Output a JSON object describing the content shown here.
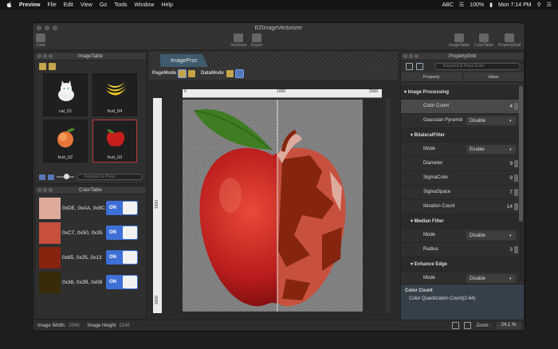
{
  "menubar": {
    "app": "Preview",
    "items": [
      "File",
      "Edit",
      "View",
      "Go",
      "Tools",
      "Window",
      "Help"
    ],
    "input": "ABC",
    "battery": "100%",
    "clock": "Mon 7:14 PM"
  },
  "window": {
    "title": "EZImageVectorizer"
  },
  "toolbar": {
    "load": "Load",
    "vectorize": "Vectorize",
    "export": "Export",
    "imagetable": "ImageTable",
    "colortable": "ColorTable",
    "propertygrid": "PropertyGrid"
  },
  "imagetable": {
    "title": "ImageTable",
    "items": [
      {
        "label": "cat_01"
      },
      {
        "label": "fruit_04"
      },
      {
        "label": "fruit_02"
      },
      {
        "label": "fruit_03"
      }
    ],
    "search_placeholder": "Keyword & Press"
  },
  "colortable": {
    "title": "ColorTable",
    "rows": [
      {
        "color": "#DEAA9C",
        "text": "0xDE, 0xAA, 0x9C",
        "state": "ON"
      },
      {
        "color": "#C7503F",
        "text": "0xC7, 0x50, 0x35",
        "state": "ON"
      },
      {
        "color": "#85250F",
        "text": "0x85, 0x25, 0x13",
        "state": "ON"
      },
      {
        "color": "#382B08",
        "text": "0x38, 0x2B, 0x08",
        "state": "ON"
      }
    ]
  },
  "center": {
    "tab": "ImageProc",
    "pagemode": "PageMode",
    "datamode": "DataMode",
    "ruler_top": [
      "0",
      "1000",
      "2000"
    ],
    "ruler_left": [
      "1000",
      "2000"
    ]
  },
  "propertygrid": {
    "title": "PropertyGrid",
    "search_placeholder": "Keyword & Press Enter",
    "col_property": "Property",
    "col_value": "Value",
    "rows": [
      {
        "name": "▾ Image Processing",
        "type": "group"
      },
      {
        "name": "Color Count",
        "value": "4",
        "type": "num",
        "selected": true
      },
      {
        "name": "Gaussian Pyramid",
        "value": "Disable",
        "type": "select"
      },
      {
        "name": "▾ BilateralFilter",
        "type": "group"
      },
      {
        "name": "Mode",
        "value": "Enable",
        "type": "select"
      },
      {
        "name": "Diameter",
        "value": "9",
        "type": "num"
      },
      {
        "name": "SigmaColor",
        "value": "9",
        "type": "num"
      },
      {
        "name": "SigmaSpace",
        "value": "7",
        "type": "num"
      },
      {
        "name": "Iteration Count",
        "value": "14",
        "type": "num"
      },
      {
        "name": "▾ Median Filter",
        "type": "group"
      },
      {
        "name": "Mode",
        "value": "Disable",
        "type": "select"
      },
      {
        "name": "Radius",
        "value": "3",
        "type": "num"
      },
      {
        "name": "▾ Enhance Edge",
        "type": "group"
      },
      {
        "name": "Mode",
        "value": "Disable",
        "type": "select"
      }
    ],
    "desc_title": "Color Count",
    "desc_text": "Color Quantization Count(2-64)"
  },
  "statusbar": {
    "width_label": "Image Width:",
    "width_value": "2040",
    "height_label": "Image Height",
    "height_value": "2245",
    "zoom_label": "Zoom :",
    "zoom_value": "24.1 %"
  },
  "colors": {
    "accent": "#3D6FD6",
    "selection": "#C03A3A",
    "apple_red": "#C7503F",
    "apple_light": "#DEAA9C",
    "apple_dark": "#85250F"
  }
}
